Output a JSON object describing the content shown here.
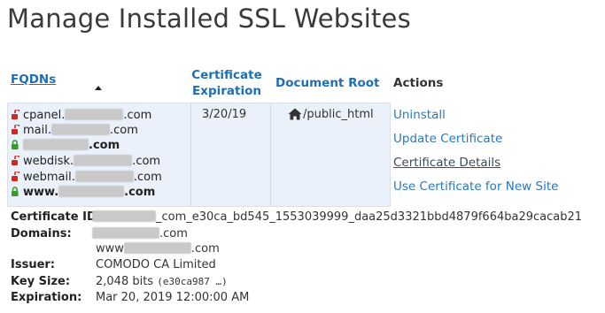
{
  "page_title": "Manage Installed SSL Websites",
  "table": {
    "headers": {
      "fqdns": "FQDNs",
      "cert_expiration": "Certificate Expiration",
      "document_root": "Document Root",
      "actions": "Actions"
    },
    "row": {
      "fqdns": [
        {
          "prefix": "cpanel.",
          "suffix": ".com",
          "bold": false,
          "lock": "unlocked"
        },
        {
          "prefix": "mail.",
          "suffix": ".com",
          "bold": false,
          "lock": "unlocked"
        },
        {
          "prefix": "",
          "suffix": ".com",
          "bold": true,
          "lock": "locked"
        },
        {
          "prefix": "webdisk.",
          "suffix": ".com",
          "bold": false,
          "lock": "unlocked"
        },
        {
          "prefix": "webmail.",
          "suffix": ".com",
          "bold": false,
          "lock": "unlocked"
        },
        {
          "prefix": "www.",
          "suffix": ".com",
          "bold": true,
          "lock": "locked"
        }
      ],
      "expiration": "3/20/19",
      "document_root": "/public_html",
      "actions": [
        "Uninstall",
        "Update Certificate",
        "Certificate Details",
        "Use Certificate for New Site"
      ]
    }
  },
  "details": {
    "certificate_id_label": "Certificate ID:",
    "certificate_id_value": "_com_e30ca_bd545_1553039999_daa25d3321bbd4879f664ba29cacab21",
    "domains_label": "Domains:",
    "domain_1_suffix": ".com",
    "domain_2_prefix": "www",
    "domain_2_suffix": ".com",
    "issuer_label": "Issuer:",
    "issuer_value": "COMODO CA Limited",
    "key_size_label": "Key Size:",
    "key_size_value": "2,048 bits",
    "key_size_id": "(e30ca987 …)",
    "expiration_label": "Expiration:",
    "expiration_value": "Mar 20, 2019 12:00:00 AM"
  },
  "colors": {
    "link": "#2a78b8",
    "unlocked_lock": "#d9261c",
    "locked_lock": "#3a9a2e",
    "row_bg": "#eaf1fa"
  }
}
